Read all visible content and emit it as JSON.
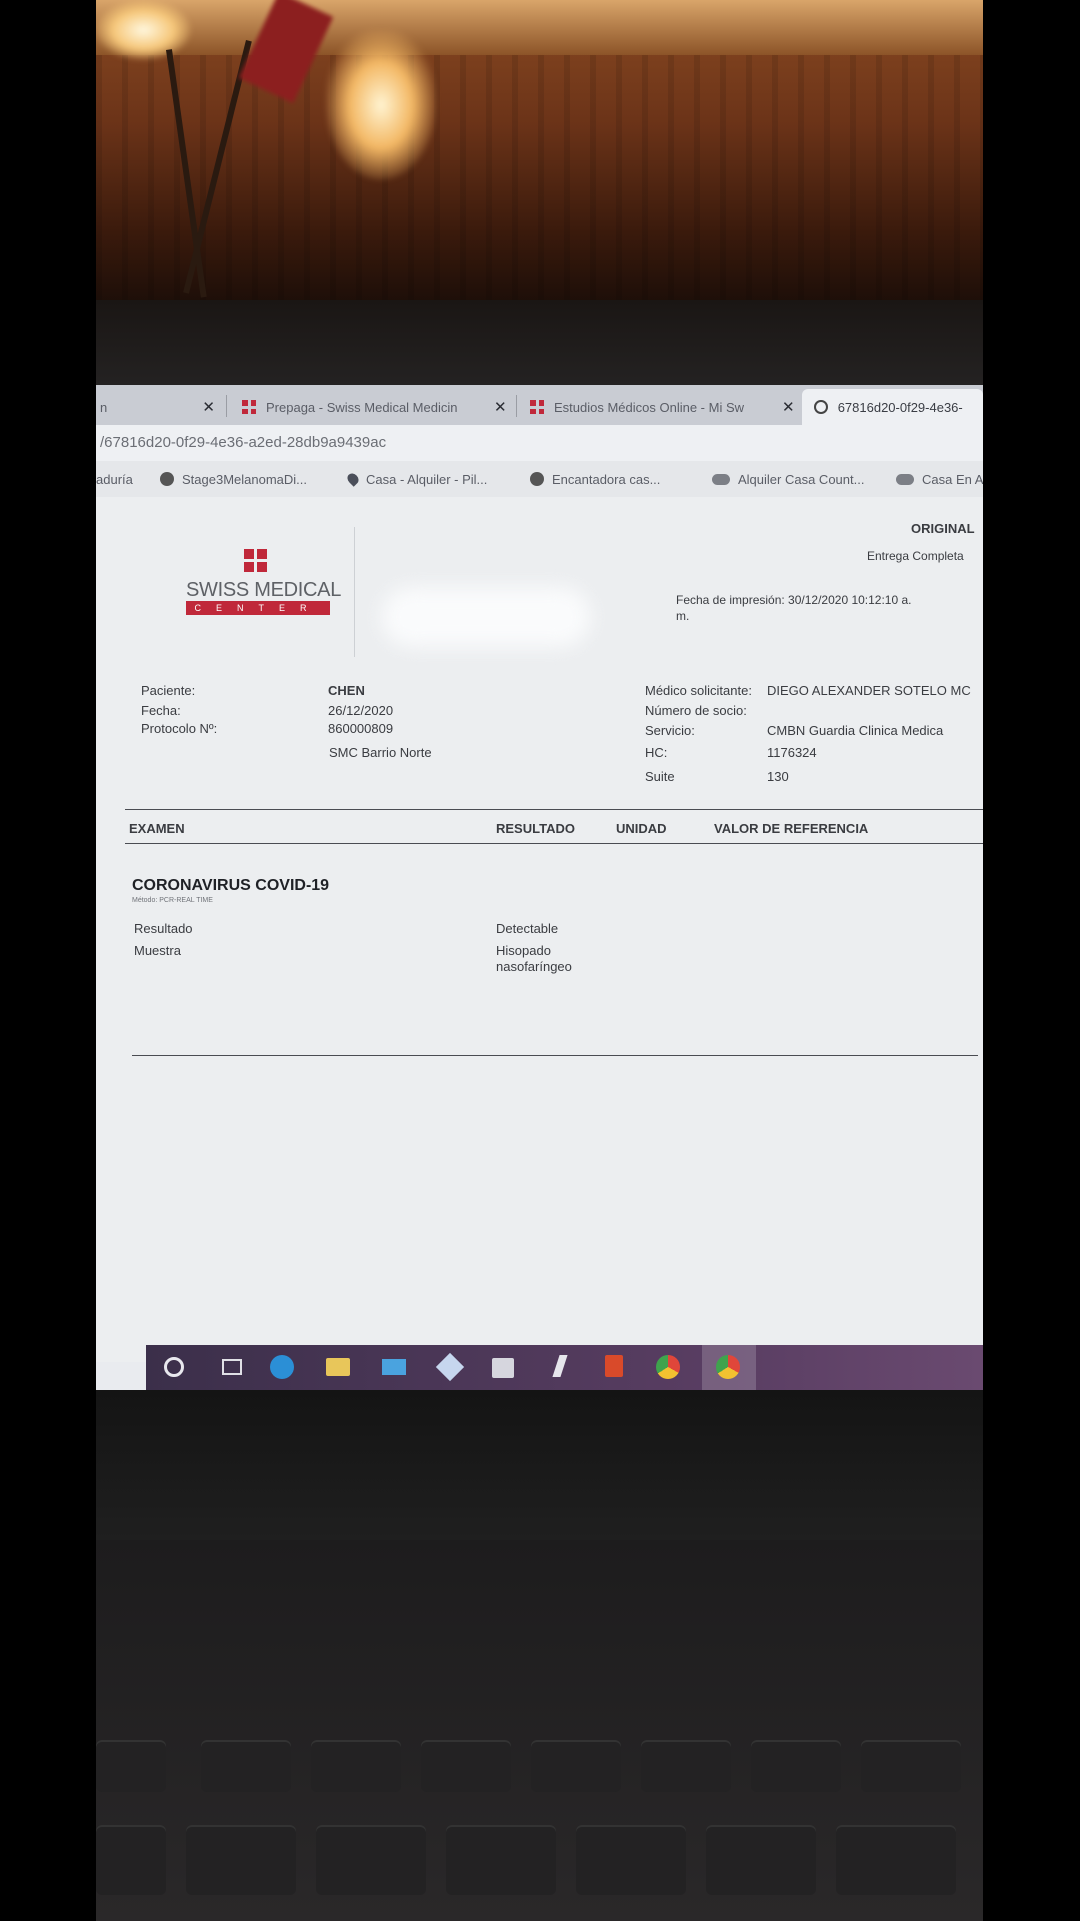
{
  "browser": {
    "tabs": [
      {
        "label": "n",
        "active": false
      },
      {
        "label": "Prepaga - Swiss Medical Medicin",
        "active": false
      },
      {
        "label": "Estudios Médicos Online - Mi Sw",
        "active": false
      },
      {
        "label": "67816d20-0f29-4e36-",
        "active": true
      }
    ],
    "address": "/67816d20-0f29-4e36-a2ed-28db9a9439ac",
    "bookmarks": [
      "aduría",
      "Stage3MelanomaDi...",
      "Casa - Alquiler - Pil...",
      "Encantadora cas...",
      "Alquiler Casa Count...",
      "Casa En A"
    ]
  },
  "report": {
    "logo": {
      "name": "SWISS MEDICAL",
      "sub": "CENTER"
    },
    "original_label": "ORIGINAL",
    "delivery_label": "Entrega Completa",
    "print_date": "Fecha de impresión: 30/12/2020 10:12:10 a.",
    "print_date_cont": "m.",
    "patient": {
      "paciente_label": "Paciente:",
      "paciente_value": "CHEN",
      "fecha_label": "Fecha:",
      "fecha_value": "26/12/2020",
      "protocolo_label": "Protocolo Nº:",
      "protocolo_value": "860000809",
      "sede_value": "SMC Barrio Norte"
    },
    "clinic": {
      "medico_label": "Médico solicitante:",
      "medico_value": "DIEGO ALEXANDER SOTELO MC",
      "socio_label": "Número de socio:",
      "servicio_label": "Servicio:",
      "servicio_value": "CMBN Guardia Clinica Medica",
      "hc_label": "HC:",
      "hc_value": "1176324",
      "suite_label": "Suite",
      "suite_value": "130"
    },
    "table_headers": {
      "examen": "EXAMEN",
      "resultado": "RESULTADO",
      "unidad": "UNIDAD",
      "referencia": "VALOR DE REFERENCIA"
    },
    "test": {
      "name": "CORONAVIRUS  COVID-19",
      "method": "Método: PCR-REAL TIME",
      "rows": [
        {
          "label": "Resultado",
          "value": "Detectable"
        },
        {
          "label": "Muestra",
          "value": "Hisopado",
          "value2": "nasofaríngeo"
        }
      ]
    }
  },
  "taskbar": {
    "icons": [
      "search-icon",
      "task-view-icon",
      "edge-icon",
      "file-explorer-icon",
      "mail-icon",
      "dropbox-icon",
      "store-icon",
      "bolt-app-icon",
      "office-icon",
      "chrome-icon",
      "chrome-active-icon"
    ]
  },
  "colors": {
    "brand_red": "#c0283a",
    "tab_close": "#2a2c33"
  }
}
